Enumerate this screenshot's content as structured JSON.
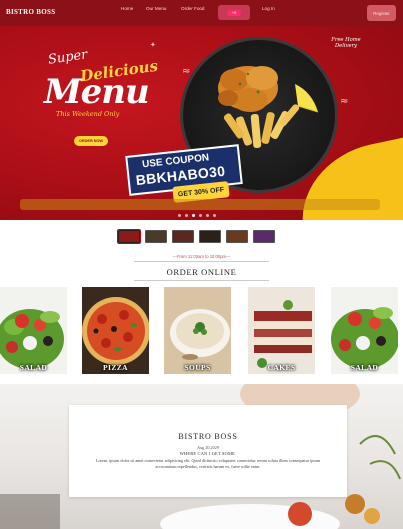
{
  "nav": {
    "brand": "BISTRO BOSS",
    "links": [
      "Home",
      "Our Menu",
      "Order Food"
    ],
    "cart_count": "+0",
    "login": "Log In",
    "register": "Register"
  },
  "hero": {
    "line_super": "Super",
    "line_delicious": "Delicious",
    "line_menu": "Menu",
    "line_weekend": "This Weekend Only",
    "order_button": "ORDER NOW",
    "home_delivery": "Free Home Delivery",
    "coupon_title": "USE COUPON",
    "coupon_code": "BBKHABO30",
    "discount": "GET 30% OFF",
    "slide_count": 6,
    "active_slide": 2
  },
  "thumbnails": {
    "count": 6,
    "active": 0
  },
  "order_section": {
    "hours": "---From 11:00am to 10:00pm---",
    "heading": "ORDER ONLINE"
  },
  "categories": [
    {
      "label": "SALAD"
    },
    {
      "label": "PIZZA"
    },
    {
      "label": "SOUPS"
    },
    {
      "label": "CAKES"
    },
    {
      "label": "SALAD"
    }
  ],
  "about": {
    "title": "BISTRO BOSS",
    "date": "Aug 20,2029",
    "subtitle": "WHERE CAN I GET SOME.",
    "body": "Lorem, ipsum dolor sit amet consectetur adipisicing elit. Quod distinctio voluptates consectetur rerum soluta illum consequatur ipsam accusantium repellendus, veritatis harum ex, fuere sollte enim."
  },
  "colors": {
    "brand_red": "#8c1017",
    "accent_yellow": "#ffd43b",
    "cart_pink": "#c63a55",
    "coupon_blue": "#1b2f6b"
  }
}
